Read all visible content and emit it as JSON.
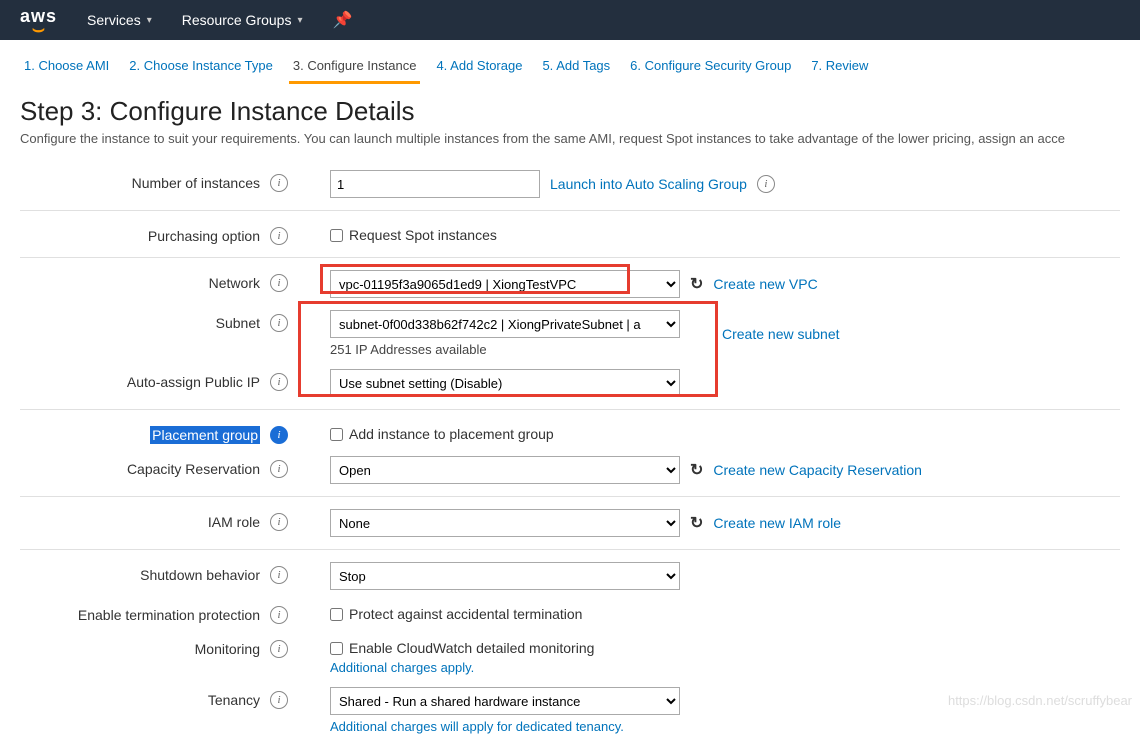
{
  "header": {
    "logo_text": "aws",
    "services": "Services",
    "resource_groups": "Resource Groups"
  },
  "wizard": {
    "tabs": [
      "1. Choose AMI",
      "2. Choose Instance Type",
      "3. Configure Instance",
      "4. Add Storage",
      "5. Add Tags",
      "6. Configure Security Group",
      "7. Review"
    ]
  },
  "page": {
    "title": "Step 3: Configure Instance Details",
    "description": "Configure the instance to suit your requirements. You can launch multiple instances from the same AMI, request Spot instances to take advantage of the lower pricing, assign an acce"
  },
  "form": {
    "num_instances": {
      "label": "Number of instances",
      "value": "1",
      "link": "Launch into Auto Scaling Group"
    },
    "purchasing": {
      "label": "Purchasing option",
      "checkbox": "Request Spot instances"
    },
    "network": {
      "label": "Network",
      "value": "vpc-01195f3a9065d1ed9 | XiongTestVPC",
      "link": "Create new VPC"
    },
    "subnet": {
      "label": "Subnet",
      "value": "subnet-0f00d338b62f742c2 | XiongPrivateSubnet | a",
      "note": "251 IP Addresses available",
      "link": "Create new subnet"
    },
    "auto_ip": {
      "label": "Auto-assign Public IP",
      "value": "Use subnet setting (Disable)"
    },
    "placement": {
      "label": "Placement group",
      "checkbox": "Add instance to placement group"
    },
    "capacity": {
      "label": "Capacity Reservation",
      "value": "Open",
      "link": "Create new Capacity Reservation"
    },
    "iam": {
      "label": "IAM role",
      "value": "None",
      "link": "Create new IAM role"
    },
    "shutdown": {
      "label": "Shutdown behavior",
      "value": "Stop"
    },
    "termination": {
      "label": "Enable termination protection",
      "checkbox": "Protect against accidental termination"
    },
    "monitoring": {
      "label": "Monitoring",
      "checkbox": "Enable CloudWatch detailed monitoring",
      "note": "Additional charges apply."
    },
    "tenancy": {
      "label": "Tenancy",
      "value": "Shared - Run a shared hardware instance",
      "note": "Additional charges will apply for dedicated tenancy."
    }
  },
  "watermark": "https://blog.csdn.net/scruffybear"
}
